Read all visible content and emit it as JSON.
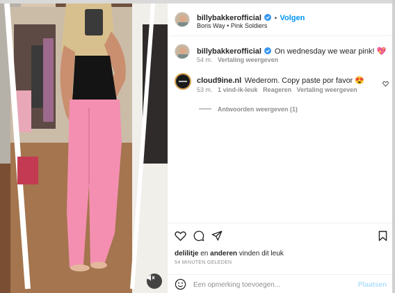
{
  "header": {
    "username": "billybakkerofficial",
    "separator": "•",
    "follow_label": "Volgen",
    "location": "Boris Way • Pink Soldiers"
  },
  "caption": {
    "username": "billybakkerofficial",
    "text": "On wednesday we wear pink! 💖",
    "time": "54 m.",
    "translate_label": "Vertaling weergeven"
  },
  "comments": [
    {
      "username": "cloud9ine.nl",
      "text": "Wederom. Copy paste por favor 😍",
      "time": "53 m.",
      "likes_label": "1 vind-ik-leuk",
      "reply_label": "Reageren",
      "translate_label": "Vertaling weergeven",
      "replies_label": "Antwoorden weergeven (1)"
    }
  ],
  "actions": {
    "likes_user": "delilitje",
    "likes_and": "en",
    "likes_others": "anderen",
    "likes_suffix": "vinden dit leuk",
    "posted_ago": "54 MINUTEN GELEDEN"
  },
  "add_comment": {
    "placeholder": "Een opmerking toevoegen...",
    "post_label": "Plaatsen"
  },
  "icons": {
    "verified": "verified-badge-icon",
    "like": "heart-icon",
    "comment": "comment-bubble-icon",
    "share": "paper-plane-icon",
    "save": "bookmark-icon",
    "emoji": "smiley-icon",
    "mute": "speaker-muted-icon"
  },
  "colors": {
    "accent": "#0095f6",
    "verified": "#3897f0",
    "pants": "#f48fb1",
    "muted_text": "#8e8e8e"
  }
}
